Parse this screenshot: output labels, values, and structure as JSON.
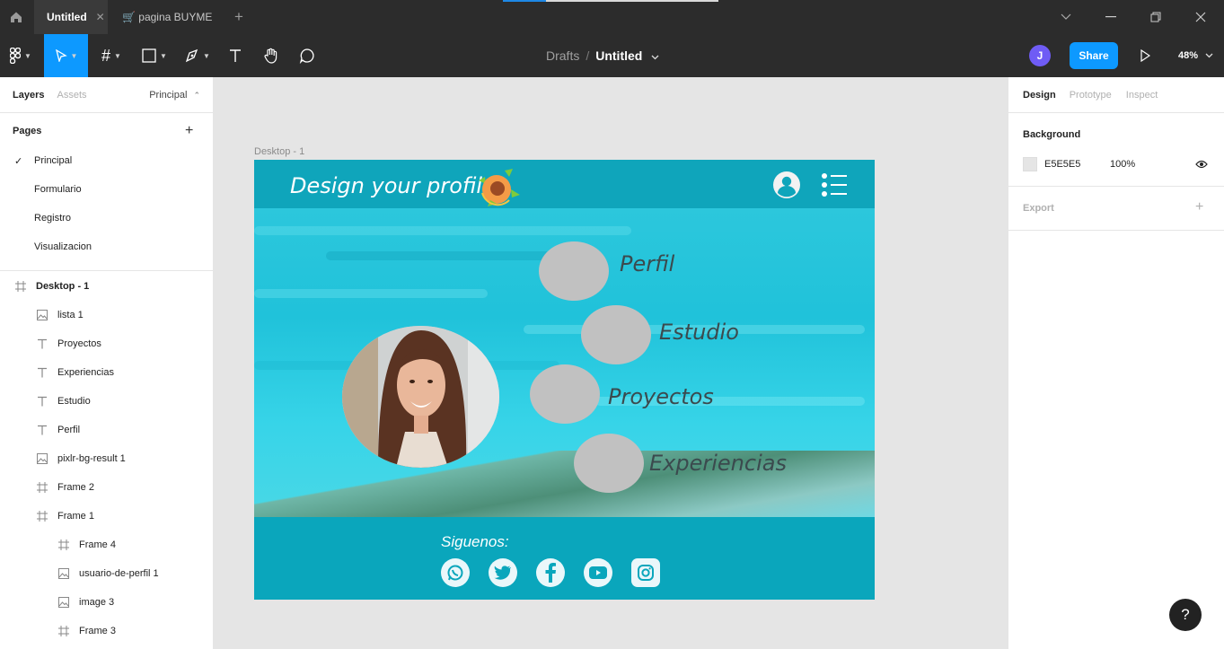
{
  "titlebar": {
    "tabs": [
      {
        "label": "Untitled",
        "active": true
      },
      {
        "label": "🛒 pagina BUYME",
        "active": false
      }
    ]
  },
  "toolbar": {
    "breadcrumb": {
      "folder": "Drafts",
      "separator": "/",
      "file": "Untitled"
    },
    "avatar_initial": "J",
    "share_label": "Share",
    "zoom": "48%"
  },
  "left_panel": {
    "tabs": {
      "layers": "Layers",
      "assets": "Assets"
    },
    "current_page": "Principal",
    "pages_title": "Pages",
    "pages": [
      "Principal",
      "Formulario",
      "Registro",
      "Visualizacion"
    ],
    "layers": [
      {
        "name": "Desktop - 1",
        "type": "frame",
        "indent": 0
      },
      {
        "name": "lista 1",
        "type": "image",
        "indent": 1
      },
      {
        "name": "Proyectos",
        "type": "text",
        "indent": 1
      },
      {
        "name": "Experiencias",
        "type": "text",
        "indent": 1
      },
      {
        "name": "Estudio",
        "type": "text",
        "indent": 1
      },
      {
        "name": "Perfil",
        "type": "text",
        "indent": 1
      },
      {
        "name": "pixlr-bg-result 1",
        "type": "image",
        "indent": 1
      },
      {
        "name": "Frame 2",
        "type": "frame",
        "indent": 1
      },
      {
        "name": "Frame 1",
        "type": "frame",
        "indent": 1
      },
      {
        "name": "Frame 4",
        "type": "frame",
        "indent": 2
      },
      {
        "name": "usuario-de-perfil 1",
        "type": "image",
        "indent": 2
      },
      {
        "name": "image 3",
        "type": "image",
        "indent": 2
      },
      {
        "name": "Frame 3",
        "type": "frame",
        "indent": 2
      }
    ]
  },
  "right_panel": {
    "tabs": {
      "design": "Design",
      "prototype": "Prototype",
      "inspect": "Inspect"
    },
    "background_title": "Background",
    "background_hex": "E5E5E5",
    "background_opacity": "100%",
    "export_title": "Export"
  },
  "canvas": {
    "frame_label": "Desktop - 1",
    "design_title": "Design your profile",
    "menu_items": [
      "Perfil",
      "Estudio",
      "Proyectos",
      "Experiencias"
    ],
    "follow_label": "Siguenos:",
    "social_icons": [
      "whatsapp-icon",
      "twitter-icon",
      "facebook-icon",
      "youtube-icon",
      "instagram-icon"
    ]
  },
  "help_label": "?",
  "colors": {
    "accent": "#0d99ff",
    "frame_header": "#0fa5bb",
    "dark_chrome": "#2c2c2c",
    "canvas_bg": "#e5e5e5"
  }
}
